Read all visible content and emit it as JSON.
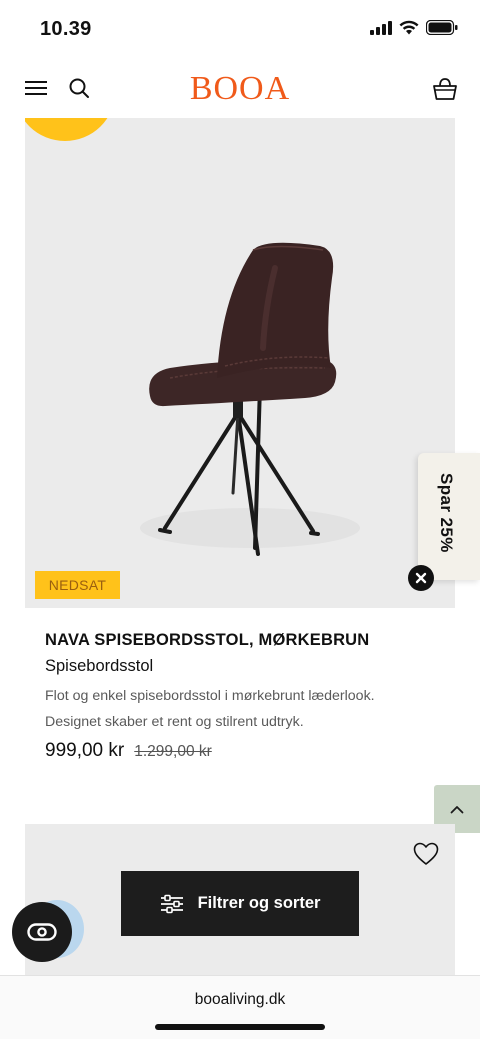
{
  "status_bar": {
    "time": "10.39"
  },
  "header": {
    "logo": "BOOA",
    "icons": [
      "menu-icon",
      "search-icon",
      "basket-icon"
    ]
  },
  "product": {
    "badge": "NEDSAT",
    "name": "NAVA SPISEBORDSSTOL, MØRKEBRUN",
    "category": "Spisebordsstol",
    "description_line1": "Flot og enkel spisebordsstol i mørkebrunt læderlook.",
    "description_line2": "Designet skaber et rent og stilrent udtryk.",
    "price": "999,00 kr",
    "old_price": "1.299,00 kr"
  },
  "promo": {
    "label": "Spar 25%"
  },
  "filter": {
    "label": "Filtrer og sorter"
  },
  "browser": {
    "url": "booaliving.dk"
  },
  "colors": {
    "brand": "#f05a1a",
    "badge": "#ffc21a",
    "card_bg": "#ebebeb",
    "scroll_top_bg": "#cad6c6",
    "dark": "#1d1d1d"
  }
}
